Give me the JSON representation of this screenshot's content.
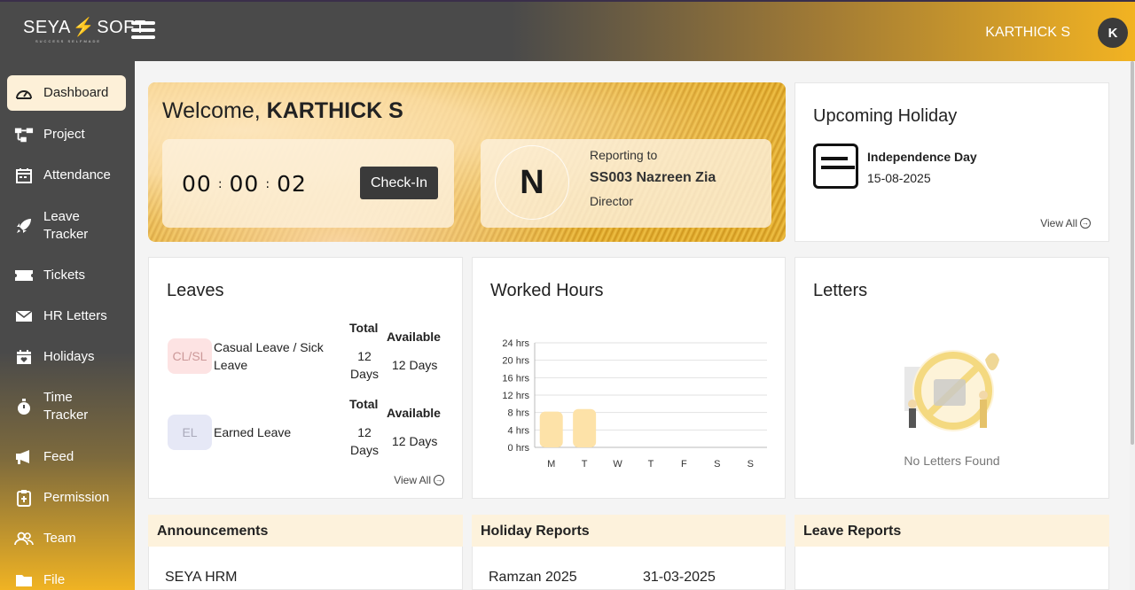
{
  "header": {
    "logo_left": "SEYA",
    "logo_right": "SOFT",
    "logo_tagline": "SUCCESS SELFMADE",
    "user_name": "KARTHICK S",
    "avatar_letter": "K"
  },
  "sidebar": {
    "items": [
      {
        "label": "Dashboard",
        "icon": "gauge-icon"
      },
      {
        "label": "Project",
        "icon": "sitemap-icon"
      },
      {
        "label": "Attendance",
        "icon": "calendar-check-icon"
      },
      {
        "label": "Leave Tracker",
        "icon": "rocket-icon"
      },
      {
        "label": "Tickets",
        "icon": "ticket-icon"
      },
      {
        "label": "HR Letters",
        "icon": "mail-icon"
      },
      {
        "label": "Holidays",
        "icon": "calendar-heart-icon"
      },
      {
        "label": "Time Tracker",
        "icon": "stopwatch-icon"
      },
      {
        "label": "Feed",
        "icon": "megaphone-icon"
      },
      {
        "label": "Permission",
        "icon": "clipboard-icon"
      },
      {
        "label": "Team",
        "icon": "users-icon"
      },
      {
        "label": "File",
        "icon": "folder-icon"
      }
    ]
  },
  "welcome": {
    "greeting": "Welcome, ",
    "name": "KARTHICK S",
    "timer": {
      "h": "00",
      "m": "00",
      "s": "02",
      "sep": ":"
    },
    "checkin_label": "Check-In",
    "reporting": {
      "initial": "N",
      "label": "Reporting to",
      "name": "SS003 Nazreen Zia",
      "role": "Director"
    }
  },
  "upcoming_holiday": {
    "title": "Upcoming Holiday",
    "name": "Independence Day",
    "date": "15-08-2025",
    "view_all": "View All"
  },
  "leaves": {
    "title": "Leaves",
    "items": [
      {
        "code": "CL/SL",
        "name": "Casual Leave / Sick Leave",
        "total_label": "Total",
        "total_value": "12",
        "total_unit": "Days",
        "available_label": "Available",
        "available_value": "12 Days"
      },
      {
        "code": "EL",
        "name": "Earned Leave",
        "total_label": "Total",
        "total_value": "12",
        "total_unit": "Days",
        "available_label": "Available",
        "available_value": "12 Days"
      }
    ],
    "view_all": "View All"
  },
  "worked_hours": {
    "title": "Worked Hours"
  },
  "chart_data": {
    "type": "bar",
    "categories": [
      "M",
      "T",
      "W",
      "T",
      "F",
      "S",
      "S"
    ],
    "values": [
      8.2,
      8.8,
      0,
      0,
      0,
      0,
      0
    ],
    "ytick_labels": [
      "0 hrs",
      "4 hrs",
      "8 hrs",
      "12 hrs",
      "16 hrs",
      "20 hrs",
      "24 hrs"
    ],
    "ylim": [
      0,
      24
    ],
    "grid": true,
    "color": "#fde2a8"
  },
  "letters": {
    "title": "Letters",
    "empty_text": "No Letters Found"
  },
  "announcements": {
    "title": "Announcements",
    "rows": [
      {
        "text": "SEYA HRM"
      }
    ]
  },
  "holiday_reports": {
    "title": "Holiday Reports",
    "rows": [
      {
        "name": "Ramzan 2025",
        "date": "31-03-2025"
      }
    ]
  },
  "leave_reports": {
    "title": "Leave Reports"
  },
  "colors": {
    "accent": "#f2b322",
    "dark": "#4a4a4a",
    "active_bg": "#fdf0d8"
  }
}
